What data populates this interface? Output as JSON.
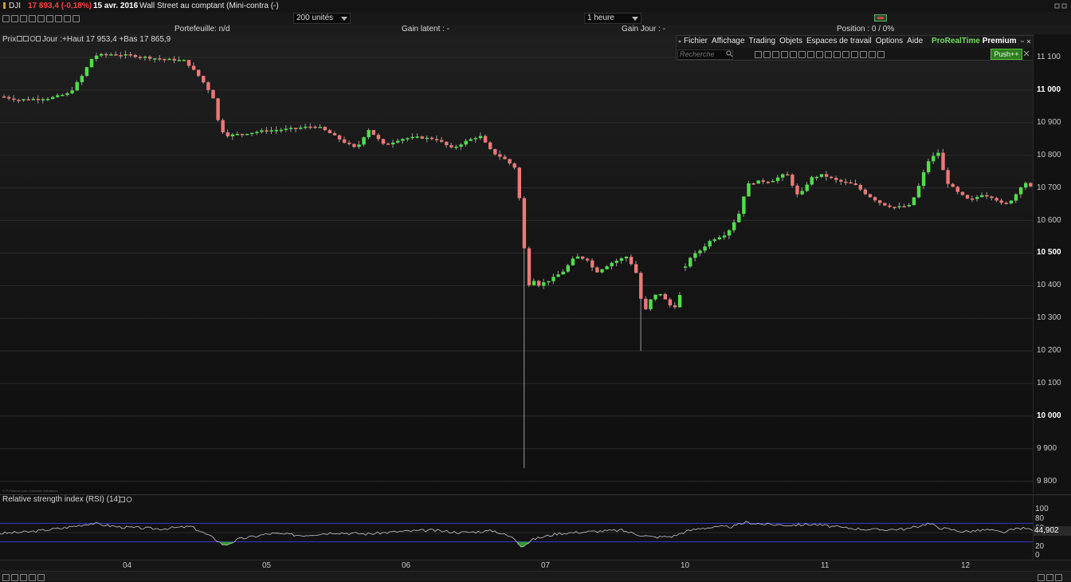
{
  "header": {
    "symbol": "DJI",
    "change": "17 893,4 (-0,18%)",
    "date": "15 avr. 2016",
    "instrument": "Wall Street au comptant (Mini-contra (-)"
  },
  "orderbar": {
    "quantity": "200 unités",
    "timeframe": "1 heure"
  },
  "infobar": {
    "portfolio": "Portefeuille: n/d",
    "unrealized": "Gain latent : -",
    "day_gain": "Gain Jour : -",
    "position": "Position : 0 / 0%"
  },
  "price_panel": {
    "label": "Prix",
    "stats": "Jour :+Haut 17 953,4 +Bas 17 865,9",
    "watermark": "© IT-Finance.com, Données indicatives"
  },
  "menu": {
    "items": [
      "Fichier",
      "Affichage",
      "Trading",
      "Objets",
      "Espaces de travail",
      "Options",
      "Aide"
    ],
    "brand_green": "ProRealTime",
    "brand_white": "Premium",
    "search_placeholder": "Recherche",
    "push_label": "Push++"
  },
  "rsi_panel": {
    "title": "Relative strength index (RSI) (14)",
    "value": "44,902",
    "levels": [
      "100",
      "80",
      "60",
      "40",
      "20",
      "0"
    ]
  },
  "colors": {
    "up": "#4ee04a",
    "down": "#f07878",
    "rsi_line": "#c8c8c8",
    "rsi_band": "#3a3ad8"
  },
  "chart_data": {
    "type": "candlestick",
    "price_ticks": [
      "11 100",
      "11 000",
      "10 900",
      "10 800",
      "10 700",
      "10 600",
      "10 500",
      "10 400",
      "10 300",
      "10 200",
      "10 100",
      "10 000",
      "9 900",
      "9 800"
    ],
    "price_bold_ticks": [
      "11 000",
      "10 500",
      "10 000"
    ],
    "ylim": [
      9780,
      11140
    ],
    "time_labels": [
      "04",
      "05",
      "06",
      "07",
      "10",
      "11",
      "12"
    ],
    "anchors": [
      [
        0,
        10980
      ],
      [
        20,
        10970
      ],
      [
        60,
        10975
      ],
      [
        85,
        10990
      ],
      [
        100,
        11040
      ],
      [
        115,
        11105
      ],
      [
        135,
        11110
      ],
      [
        165,
        11105
      ],
      [
        200,
        11095
      ],
      [
        230,
        11090
      ],
      [
        250,
        11035
      ],
      [
        265,
        10980
      ],
      [
        272,
        10900
      ],
      [
        280,
        10860
      ],
      [
        300,
        10865
      ],
      [
        330,
        10875
      ],
      [
        360,
        10880
      ],
      [
        395,
        10890
      ],
      [
        410,
        10870
      ],
      [
        430,
        10840
      ],
      [
        445,
        10820
      ],
      [
        460,
        10880
      ],
      [
        480,
        10830
      ],
      [
        500,
        10850
      ],
      [
        520,
        10855
      ],
      [
        545,
        10850
      ],
      [
        565,
        10820
      ],
      [
        580,
        10840
      ],
      [
        600,
        10860
      ],
      [
        615,
        10810
      ],
      [
        630,
        10790
      ],
      [
        645,
        10760
      ],
      [
        652,
        10620
      ],
      [
        660,
        10390
      ],
      [
        665,
        10430
      ],
      [
        672,
        10400
      ],
      [
        690,
        10420
      ],
      [
        705,
        10445
      ],
      [
        720,
        10490
      ],
      [
        735,
        10480
      ],
      [
        745,
        10440
      ],
      [
        765,
        10470
      ],
      [
        785,
        10490
      ],
      [
        798,
        10430
      ],
      [
        805,
        10310
      ],
      [
        815,
        10360
      ],
      [
        825,
        10380
      ],
      [
        838,
        10340
      ],
      [
        848,
        10335
      ],
      [
        860,
        10480
      ],
      [
        875,
        10505
      ],
      [
        890,
        10540
      ],
      [
        910,
        10560
      ],
      [
        925,
        10620
      ],
      [
        935,
        10710
      ],
      [
        950,
        10720
      ],
      [
        965,
        10720
      ],
      [
        985,
        10745
      ],
      [
        1000,
        10670
      ],
      [
        1015,
        10730
      ],
      [
        1030,
        10740
      ],
      [
        1050,
        10720
      ],
      [
        1070,
        10710
      ],
      [
        1085,
        10680
      ],
      [
        1105,
        10650
      ],
      [
        1120,
        10640
      ],
      [
        1140,
        10645
      ],
      [
        1150,
        10700
      ],
      [
        1162,
        10780
      ],
      [
        1175,
        10810
      ],
      [
        1185,
        10720
      ],
      [
        1200,
        10685
      ],
      [
        1215,
        10660
      ],
      [
        1230,
        10680
      ],
      [
        1245,
        10670
      ],
      [
        1258,
        10645
      ],
      [
        1270,
        10670
      ],
      [
        1283,
        10720
      ],
      [
        1292,
        10700
      ]
    ],
    "rsi_anchors": [
      [
        0,
        48
      ],
      [
        40,
        52
      ],
      [
        80,
        60
      ],
      [
        115,
        70
      ],
      [
        150,
        62
      ],
      [
        200,
        58
      ],
      [
        240,
        63
      ],
      [
        268,
        38
      ],
      [
        282,
        22
      ],
      [
        300,
        36
      ],
      [
        340,
        48
      ],
      [
        380,
        44
      ],
      [
        420,
        50
      ],
      [
        460,
        47
      ],
      [
        500,
        52
      ],
      [
        540,
        55
      ],
      [
        580,
        50
      ],
      [
        620,
        54
      ],
      [
        645,
        38
      ],
      [
        655,
        20
      ],
      [
        670,
        36
      ],
      [
        700,
        48
      ],
      [
        740,
        52
      ],
      [
        780,
        55
      ],
      [
        800,
        46
      ],
      [
        820,
        40
      ],
      [
        845,
        42
      ],
      [
        860,
        52
      ],
      [
        880,
        60
      ],
      [
        920,
        63
      ],
      [
        935,
        72
      ],
      [
        960,
        68
      ],
      [
        990,
        66
      ],
      [
        1020,
        68
      ],
      [
        1060,
        60
      ],
      [
        1100,
        56
      ],
      [
        1140,
        58
      ],
      [
        1165,
        70
      ],
      [
        1180,
        60
      ],
      [
        1210,
        52
      ],
      [
        1240,
        56
      ],
      [
        1258,
        50
      ],
      [
        1280,
        60
      ],
      [
        1296,
        56
      ]
    ]
  }
}
